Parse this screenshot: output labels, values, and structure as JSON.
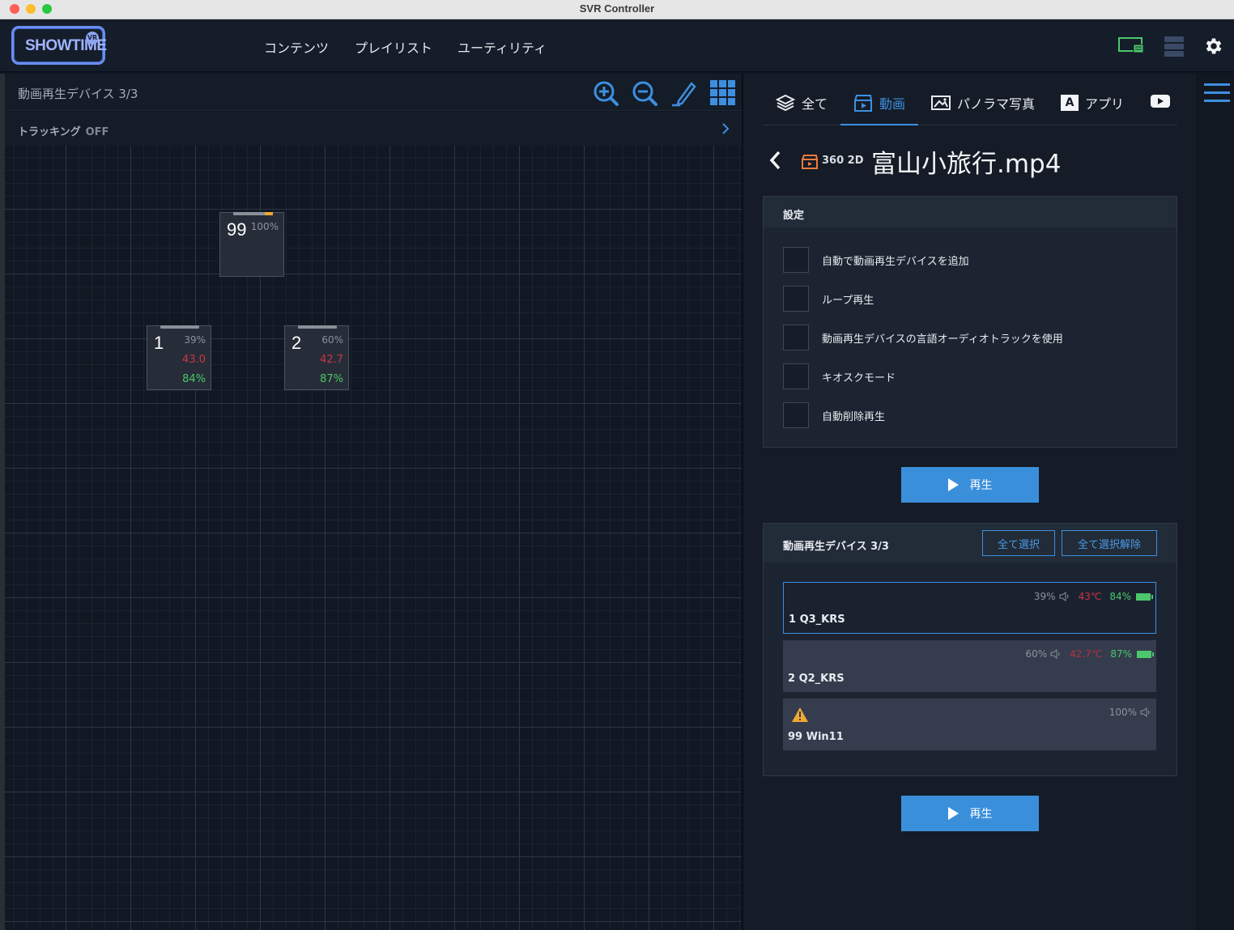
{
  "window": {
    "title": "SVR Controller"
  },
  "header": {
    "logo_text": "SHOWTIME",
    "logo_badge": "VR",
    "nav": [
      "コンテンツ",
      "プレイリスト",
      "ユーティリティ"
    ]
  },
  "left": {
    "title": "動画再生デバイス 3/3",
    "tracking_label": "トラッキング",
    "tracking_state": "OFF",
    "devices": [
      {
        "num": "99",
        "percent": "100%",
        "temp": "",
        "battery": ""
      },
      {
        "num": "1",
        "percent": "39%",
        "temp": "43.0",
        "battery": "84%"
      },
      {
        "num": "2",
        "percent": "60%",
        "temp": "42.7",
        "battery": "87%"
      }
    ]
  },
  "tabs": [
    {
      "label": "全て",
      "icon": "layers-icon"
    },
    {
      "label": "動画",
      "icon": "clapperboard-icon",
      "active": true
    },
    {
      "label": "パノラマ写真",
      "icon": "image-icon"
    },
    {
      "label": "アプリ",
      "icon": "app-icon",
      "icon_letter": "A"
    },
    {
      "label": "",
      "icon": "youtube-icon"
    }
  ],
  "media": {
    "type": "360 2D",
    "title": "富山小旅行.mp4"
  },
  "settings": {
    "title": "設定",
    "options": [
      "自動で動画再生デバイスを追加",
      "ループ再生",
      "動画再生デバイスの言語オーディオトラックを使用",
      "キオスクモード",
      "自動削除再生"
    ]
  },
  "play_label": "再生",
  "device_list": {
    "title": "動画再生デバイス 3/3",
    "select_all": "全て選択",
    "deselect_all": "全て選択解除",
    "rows": [
      {
        "name": "1  Q3_KRS",
        "percent": "39%",
        "temp": "43℃",
        "battery": "84%",
        "selected": true
      },
      {
        "name": "2  Q2_KRS",
        "percent": "60%",
        "temp": "42.7℃",
        "battery": "87%",
        "selected": false
      },
      {
        "name": "99  Win11",
        "percent": "100%",
        "temp": "",
        "battery": "",
        "warning": true
      }
    ]
  },
  "colors": {
    "accent": "#3d8fdf",
    "temp": "#cc3344",
    "battery": "#4cc76b",
    "warning": "#f0a830"
  }
}
